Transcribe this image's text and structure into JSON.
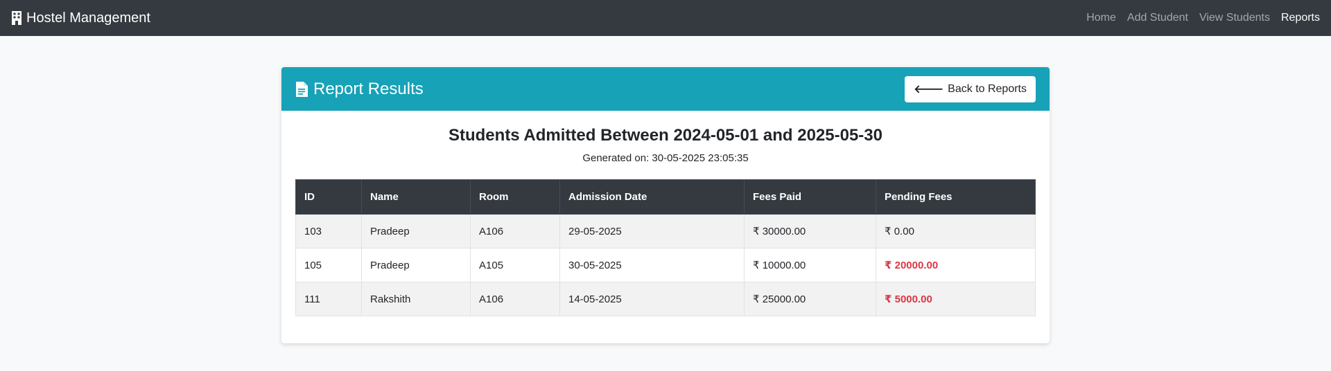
{
  "navbar": {
    "brand": "Hostel Management",
    "brand_icon": "building-icon",
    "links": [
      {
        "label": "Home",
        "active": false
      },
      {
        "label": "Add Student",
        "active": false
      },
      {
        "label": "View Students",
        "active": false
      },
      {
        "label": "Reports",
        "active": true
      }
    ]
  },
  "card": {
    "title": "Report Results",
    "title_icon": "file-text-icon",
    "back_button": "Back to Reports",
    "back_icon": "arrow-left-icon",
    "header_color": "#17a2b8"
  },
  "report": {
    "heading": "Students Admitted Between 2024-05-01 and 2025-05-30",
    "generated": "Generated on: 30-05-2025 23:05:35"
  },
  "table": {
    "columns": [
      "ID",
      "Name",
      "Room",
      "Admission Date",
      "Fees Paid",
      "Pending Fees"
    ],
    "rows": [
      {
        "id": "103",
        "name": "Pradeep",
        "room": "A106",
        "admission_date": "29-05-2025",
        "fees_paid": "₹ 30000.00",
        "pending_fees": "₹ 0.00",
        "pending_due": false
      },
      {
        "id": "105",
        "name": "Pradeep",
        "room": "A105",
        "admission_date": "30-05-2025",
        "fees_paid": "₹ 10000.00",
        "pending_fees": "₹ 20000.00",
        "pending_due": true
      },
      {
        "id": "111",
        "name": "Rakshith",
        "room": "A106",
        "admission_date": "14-05-2025",
        "fees_paid": "₹ 25000.00",
        "pending_fees": "₹ 5000.00",
        "pending_due": true
      }
    ]
  },
  "colors": {
    "navbar": "#343a40",
    "accent": "#17a2b8",
    "danger": "#dc3545"
  }
}
